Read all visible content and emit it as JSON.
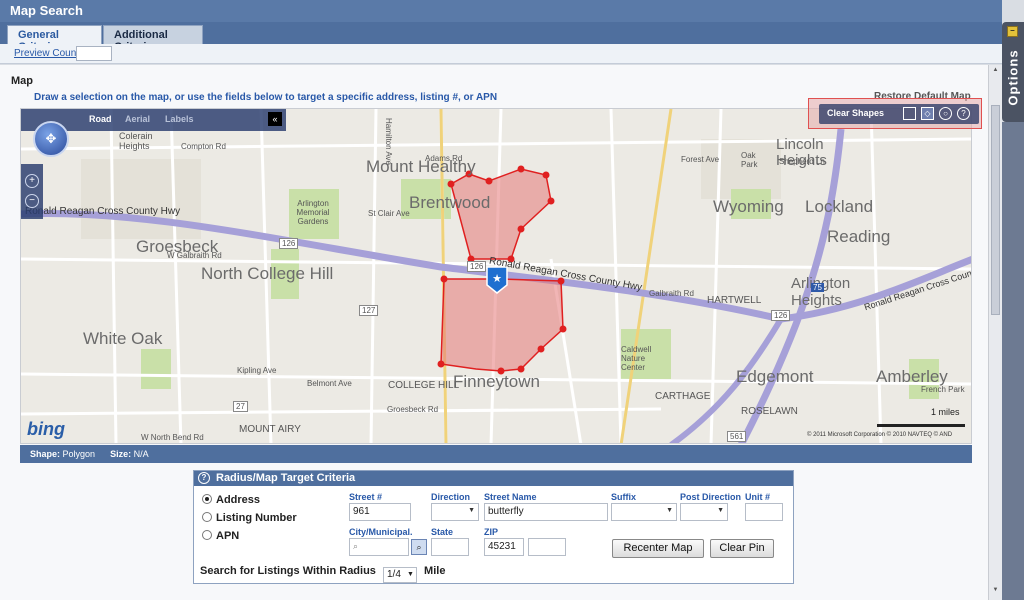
{
  "window": {
    "title": "Map Search"
  },
  "tabs": [
    {
      "label": "General Criteria",
      "active": true
    },
    {
      "label": "Additional Criteria",
      "active": false
    }
  ],
  "subbar": {
    "preview_count_label": "Preview Count"
  },
  "map_section": {
    "title": "Map",
    "instructions": "Draw a selection on the map, or use the fields below to target a specific address, listing #, or APN",
    "restore_label": "Restore Default Map",
    "nav": {
      "road": "Road",
      "aerial": "Aerial",
      "labels": "Labels",
      "collapse": "«"
    },
    "shape_tools": {
      "clear_label": "Clear Shapes",
      "icons": [
        "rectangle-icon",
        "polygon-icon",
        "circle-icon",
        "help-icon"
      ]
    },
    "places": {
      "mount_healthy": "Mount Healthy",
      "brentwood": "Brentwood",
      "groesbeck": "Groesbeck",
      "north_college_hill": "North College Hill",
      "white_oak": "White Oak",
      "finneytown": "Finneytown",
      "wyoming": "Wyoming",
      "lockland": "Lockland",
      "reading": "Reading",
      "lincoln_heights": "Lincoln Heights",
      "arlington_heights": "Arlington Heights",
      "edgemont": "Edgemont",
      "amberley": "Amberley",
      "colerain_heights": "Colerain Heights",
      "arlington_memorial": "Arlington Memorial Gardens",
      "college_hill": "COLLEGE HILL",
      "mount_airy": "MOUNT AIRY",
      "hartwell": "HARTWELL",
      "carthage": "CARTHAGE",
      "roselawn": "ROSELAWN",
      "caldwell": "Caldwell Nature Center",
      "oak_park": "Oak Park",
      "french_park": "French Park"
    },
    "roads": {
      "rr_hwy_west": "Ronald Reagan Cross County Hwy",
      "rr_hwy_mid": "Ronald Reagan Cross County Hwy",
      "rr_hwy_east": "Ronald Reagan Cross County Hwy",
      "w_galbraith": "W Galbraith Rd",
      "galbraith": "Galbraith Rd",
      "compton": "Compton Rd",
      "adams": "Adams Rd",
      "st_clair": "St Clair Ave",
      "kipling": "Kipling Ave",
      "belmont": "Belmont Ave",
      "groesbeck_rd": "Groesbeck Rd",
      "w_north_bend": "W North Bend Rd",
      "forest_ave": "Forest Ave",
      "shepherd": "Shepherd Ln",
      "hamilton": "Hamilton Ave"
    },
    "shields": {
      "i126a": "126",
      "i126b": "126",
      "i126c": "126",
      "i127": "127",
      "i27": "27",
      "i561": "561",
      "i75": "75"
    },
    "logo": "bing",
    "scale_label": "1 miles",
    "copyright": "© 2011 Microsoft Corporation  © 2010 NAVTEQ  © AND",
    "shape_info": {
      "shape_label": "Shape:",
      "shape_value": "Polygon",
      "size_label": "Size:",
      "size_value": "N/A"
    }
  },
  "criteria": {
    "title": "Radius/Map Target Criteria",
    "search_by": [
      {
        "label": "Address",
        "selected": true
      },
      {
        "label": "Listing Number",
        "selected": false
      },
      {
        "label": "APN",
        "selected": false
      }
    ],
    "fields": {
      "street_no": {
        "label": "Street #",
        "value": "961"
      },
      "direction": {
        "label": "Direction",
        "value": ""
      },
      "street_name": {
        "label": "Street Name",
        "value": "butterfly"
      },
      "suffix": {
        "label": "Suffix",
        "value": ""
      },
      "post_direction": {
        "label": "Post Direction",
        "value": ""
      },
      "unit_no": {
        "label": "Unit #",
        "value": ""
      },
      "city": {
        "label": "City/Municipal.",
        "value": ""
      },
      "state": {
        "label": "State",
        "value": ""
      },
      "zip": {
        "label": "ZIP",
        "value": "45231",
        "ext": ""
      }
    },
    "buttons": {
      "recenter": "Recenter Map",
      "clear_pin": "Clear Pin"
    },
    "radius": {
      "prefix": "Search for Listings Within Radius",
      "value": "1/4",
      "unit": "Mile"
    }
  },
  "options_panel": {
    "label": "Options",
    "min_symbol": "–"
  },
  "colors": {
    "header": "#5a7aa8",
    "link": "#2858a8",
    "polygon_fill": "#e58a8a",
    "polygon_stroke": "#e02020",
    "highway": "#a6a0d8"
  }
}
